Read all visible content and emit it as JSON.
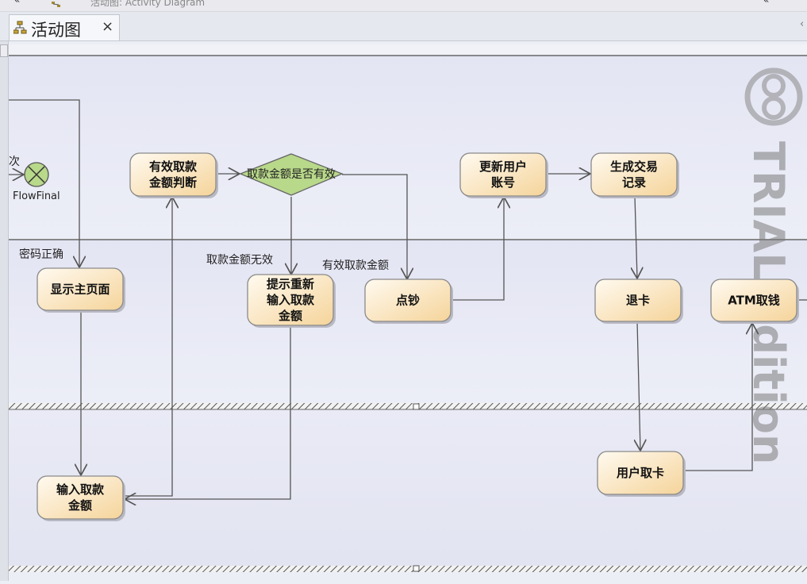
{
  "window": {
    "title": "活动图:  Activity Diagram",
    "nav_left": "«",
    "nav_right": "«"
  },
  "tab": {
    "label": "活动图",
    "close": "×",
    "overflow": "‹"
  },
  "nodes": {
    "valid_check": [
      "有效取款",
      "金额判断"
    ],
    "update_account": [
      "更新用户",
      "账号"
    ],
    "gen_record": [
      "生成交易",
      "记录"
    ],
    "show_main": [
      "显示主页面"
    ],
    "prompt_reinput": [
      "提示重新",
      "输入取款",
      "金额"
    ],
    "count_cash": [
      "点钞"
    ],
    "eject_card": [
      "退卡"
    ],
    "atm_cash": [
      "ATM取钱"
    ],
    "input_amount": [
      "输入取款",
      "金额"
    ],
    "user_take_card": [
      "用户取卡"
    ]
  },
  "decision": {
    "label": "取款金额是否有效"
  },
  "flow_final": {
    "label": "FlowFinal"
  },
  "edge_labels": {
    "password_ok": "密码正确",
    "amount_invalid": "取款金额无效",
    "amount_valid": "有效取款金额",
    "times": "次"
  },
  "watermark": {
    "text": "TRIAL Edition"
  },
  "colors": {
    "node_fill_top": "#fff8ea",
    "node_fill_bottom": "#f7dca8",
    "node_border": "#8a8a8a",
    "decision_fill": "#b8d88a",
    "lane_bg": "#e6e7f3",
    "edge": "#555555"
  }
}
